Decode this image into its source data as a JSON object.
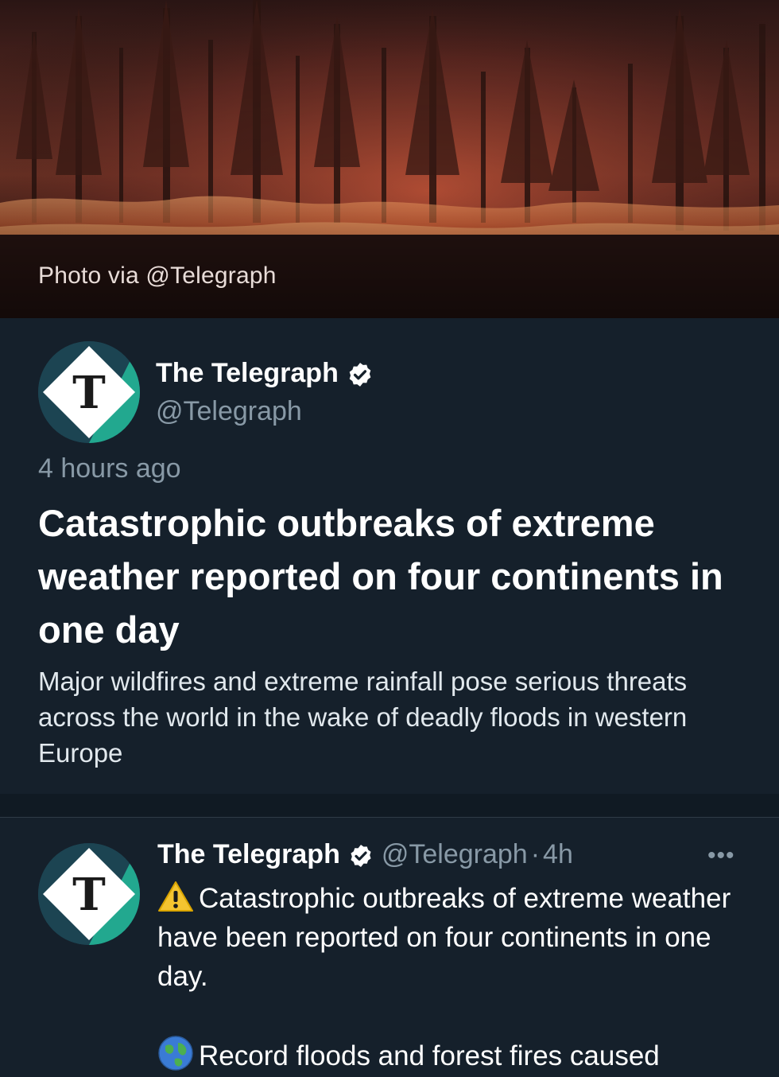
{
  "hero": {
    "caption": "Photo via @Telegraph"
  },
  "event": {
    "author_name": "The Telegraph",
    "author_handle": "@Telegraph",
    "time": "4 hours ago",
    "headline": "Catastrophic outbreaks of extreme weather reported on four continents in one day",
    "summary": "Major wildfires and extreme rainfall pose serious threats across the world in the wake of deadly floods in western Europe",
    "avatar_icon": "telegraph-logo-icon",
    "verified_icon": "verified-badge-icon"
  },
  "tweet": {
    "author_name": "The Telegraph",
    "author_handle": "@Telegraph",
    "separator": "·",
    "time": "4h",
    "more_icon": "more-options-icon",
    "line1": "Catastrophic outbreaks of extreme weather have been reported on four continents in one day.",
    "line2": "Record floods and forest fires caused",
    "line1_icon": "warning-emoji-icon",
    "line2_icon": "globe-emoji-icon"
  },
  "colors": {
    "background": "#15202b",
    "secondary_text": "#8899a6",
    "verified": "#ffffff",
    "logo_teal": "#22a88f"
  }
}
